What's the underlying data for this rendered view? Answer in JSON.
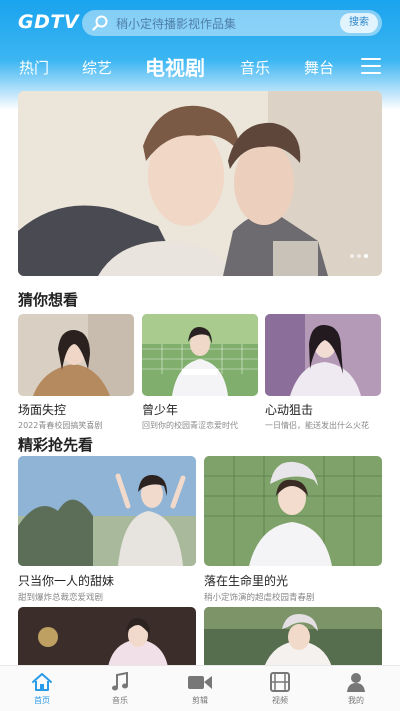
{
  "app": {
    "logo": "GDTV"
  },
  "search": {
    "placeholder": "稍小定待播影视作品集",
    "button": "搜索"
  },
  "tabs": [
    {
      "label": "热门"
    },
    {
      "label": "综艺"
    },
    {
      "label": "电视剧",
      "active": true
    },
    {
      "label": "音乐"
    },
    {
      "label": "舞台"
    }
  ],
  "banner": {
    "dots": 3,
    "active_dot": 3
  },
  "guess": {
    "title": "猜你想看",
    "items": [
      {
        "title": "场面失控",
        "subtitle": "2022青春校园搞笑喜剧"
      },
      {
        "title": "曾少年",
        "subtitle": "回到你的校园青涩恋爱时代"
      },
      {
        "title": "心动狙击",
        "subtitle": "一日情侣，能送发出什么火花"
      }
    ]
  },
  "preview": {
    "title": "精彩抢先看",
    "items": [
      {
        "title": "只当你一人的甜妹",
        "subtitle": "甜到爆炸总裁恋爱戏剧"
      },
      {
        "title": "落在生命里的光",
        "subtitle": "稍小定饰演的超虐校园青春剧"
      }
    ]
  },
  "bottom_nav": [
    {
      "label": "首页",
      "icon": "home-icon",
      "active": true
    },
    {
      "label": "音乐",
      "icon": "music-note-icon"
    },
    {
      "label": "剪辑",
      "icon": "video-camera-icon"
    },
    {
      "label": "视频",
      "icon": "film-icon"
    },
    {
      "label": "我的",
      "icon": "person-icon"
    }
  ],
  "colors": {
    "brand": "#1aa3ee",
    "active_nav": "#2a9be8"
  }
}
